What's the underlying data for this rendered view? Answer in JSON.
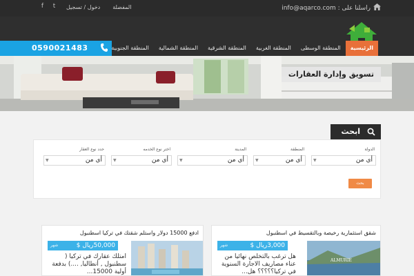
{
  "topbar": {
    "contact": "راسلنا على : info@aqarco.com",
    "links": {
      "login": "دخول / تسجيل",
      "favorites": "المفضلة"
    },
    "social": [
      "facebook-icon",
      "twitter-icon"
    ]
  },
  "nav": {
    "phone": "0590021483",
    "items": [
      {
        "label": "الرئيسية",
        "active": true
      },
      {
        "label": "المنطقة الوسطى",
        "active": false
      },
      {
        "label": "المنطقة الغربية",
        "active": false
      },
      {
        "label": "المنطقة الشرقية",
        "active": false
      },
      {
        "label": "المنطقة الشمالية",
        "active": false
      },
      {
        "label": "المنطقة الجنوبية",
        "active": false
      }
    ]
  },
  "hero": {
    "caption": "تسويق وإدارة العقارات"
  },
  "search": {
    "tab_label": "ابحث",
    "fields": [
      {
        "label": "الدولة",
        "value": "أي من"
      },
      {
        "label": "المنطقة",
        "value": "أي من"
      },
      {
        "label": "المدينة",
        "value": "أي من"
      },
      {
        "label": "اختر نوع الخدمه",
        "value": "أي من"
      },
      {
        "label": "حدد نوع العقار",
        "value": "أي من"
      }
    ],
    "submit_label": "بحث"
  },
  "listings": [
    {
      "title": "شقق استثمارية رخيصة وبالتقسيط في اسطنبول",
      "price": "3,000ريال $",
      "unit": "شهر",
      "description": "هل ترغب بالتخلص نهائيا من عناء مصاريف الاجارة السنوية في تركيا؟؟؟؟؟ هل..."
    },
    {
      "title": "ادفع 15000 دولار واستلم شقتك في تركيا اسطنبول",
      "price": "50,000ريال $",
      "unit": "شهر",
      "description": "امتلك عقارك في تركيا ( سطنبول , أنطاليا, ....) بدفعة أولية 15000..."
    }
  ],
  "colors": {
    "accent_orange": "#e8703a",
    "accent_blue": "#1aa3e3",
    "dark_bar": "#2f2f2f",
    "price_blue": "#3cb2e8",
    "button_orange": "#f08a46"
  }
}
